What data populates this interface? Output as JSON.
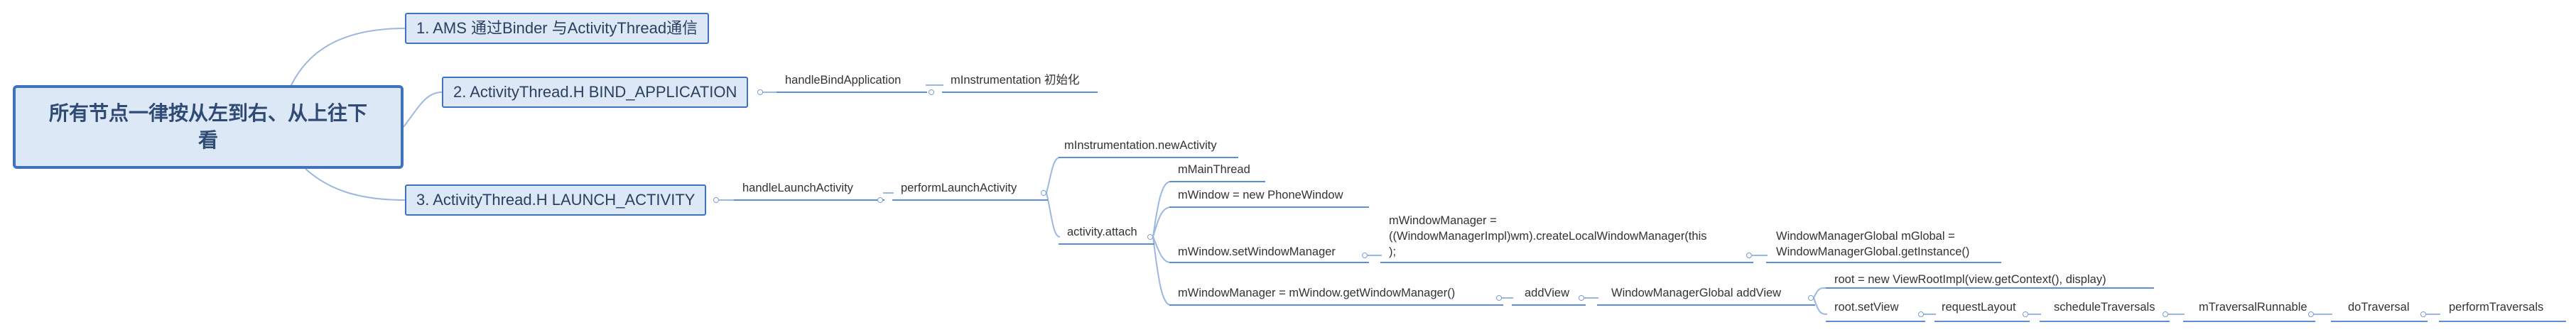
{
  "root": {
    "label": "所有节点一律按从左到右、从上往下看"
  },
  "branches": [
    {
      "label": "1. AMS 通过Binder 与ActivityThread通信"
    },
    {
      "label": "2. ActivityThread.H   BIND_APPLICATION"
    },
    {
      "label": "3. ActivityThread.H   LAUNCH_ACTIVITY"
    }
  ],
  "nodes": {
    "handleBindApplication": "handleBindApplication",
    "mInstrumentationInit": "mInstrumentation 初始化",
    "handleLaunchActivity": "handleLaunchActivity",
    "performLaunchActivity": "performLaunchActivity",
    "newActivity": "mInstrumentation.newActivity",
    "activityAttach": "activity.attach",
    "mMainThread": "mMainThread",
    "newPhoneWindow": "mWindow = new PhoneWindow",
    "setWindowManager": "mWindow.setWindowManager",
    "createLocalWM": "mWindowManager =\n((WindowManagerImpl)wm).createLocalWindowManager(this\n);",
    "wmGlobalInstance": "WindowManagerGlobal mGlobal =\nWindowManagerGlobal.getInstance()",
    "getWindowManager": "mWindowManager = mWindow.getWindowManager()",
    "addView": "addView",
    "globalAddView": "WindowManagerGlobal addView",
    "newViewRootImpl": "root = new ViewRootImpl(view.getContext(), display)",
    "rootSetView": "root.setView",
    "requestLayout": "requestLayout",
    "scheduleTraversals": "scheduleTraversals",
    "mTraversalRunnable": "mTraversalRunnable",
    "doTraversal": "doTraversal",
    "performTraversals": "performTraversals"
  }
}
